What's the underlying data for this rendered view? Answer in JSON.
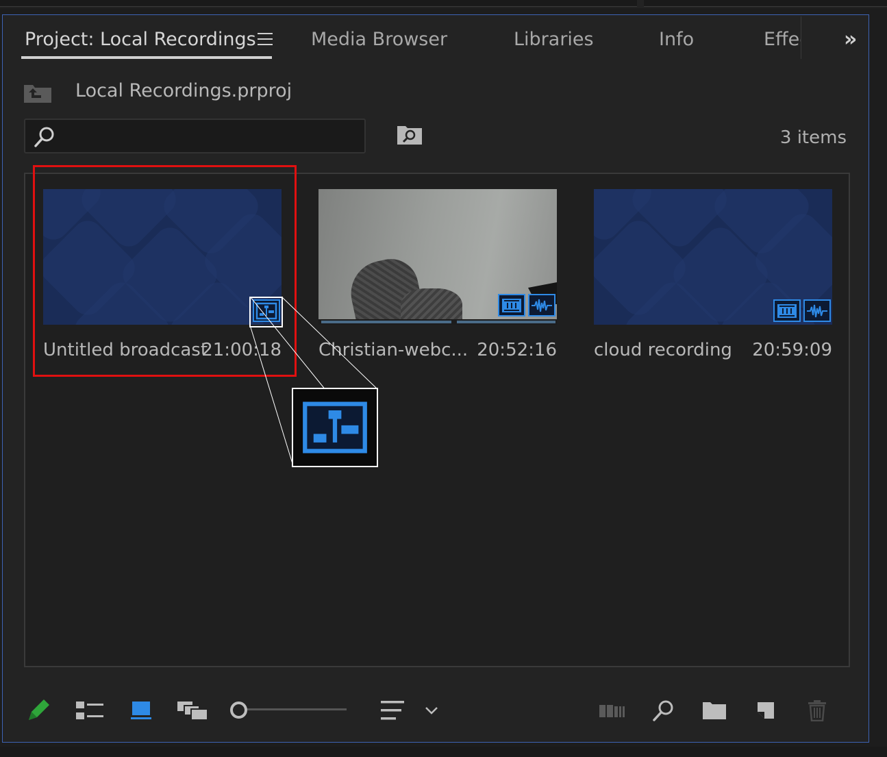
{
  "tabs": {
    "project": "Project: Local Recordings",
    "media_browser": "Media Browser",
    "libraries": "Libraries",
    "info": "Info",
    "effects": "Effec",
    "overflow": "»"
  },
  "bin": {
    "name": "Local Recordings.prproj"
  },
  "search": {
    "value": "",
    "placeholder": ""
  },
  "items_count": "3 items",
  "clips": [
    {
      "name": "Untitled broadcast",
      "duration": "21:00:18",
      "type": "sequence"
    },
    {
      "name": "Christian-webc...",
      "duration": "20:52:16",
      "type": "video+audio"
    },
    {
      "name": "cloud recording",
      "duration": "20:59:09",
      "type": "video+audio"
    }
  ],
  "colors": {
    "accent_blue": "#2e8ae6",
    "selection_red": "#e01010",
    "panel_border": "#3e63b5",
    "pencil_green": "#2fa63a"
  },
  "icons": {
    "bin_up": "folder-up-icon",
    "search": "search-icon",
    "find_bin": "find-bin-icon",
    "sequence_badge": "sequence-icon",
    "video_badge": "film-icon",
    "audio_badge": "waveform-icon",
    "toolbar": [
      "pencil-icon",
      "list-view-icon",
      "icon-view-icon",
      "freeform-view-icon",
      "zoom-slider",
      "sort-icon",
      "chevron-down-icon",
      "automate-to-sequence-icon",
      "find-icon",
      "new-bin-icon",
      "new-item-icon",
      "trash-icon"
    ]
  }
}
